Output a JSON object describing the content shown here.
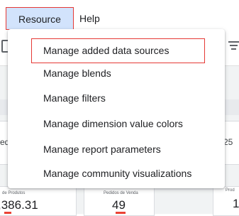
{
  "menubar": {
    "resource_label": "Resource",
    "help_label": "Help"
  },
  "resource_menu": {
    "items": [
      {
        "label": "Manage added data sources",
        "highlighted": true
      },
      {
        "label": "Manage blends"
      },
      {
        "label": "Manage filters"
      },
      {
        "label": "Manage dimension value colors"
      },
      {
        "label": "Manage report parameters"
      },
      {
        "label": "Manage community visualizations"
      }
    ]
  },
  "background": {
    "left_card_text": "ed",
    "right_card_text": "25",
    "kpis": [
      {
        "label": "de Produtos",
        "value": ",386.31"
      },
      {
        "label": "Pedidos de Venda",
        "value": "49"
      },
      {
        "label": "Prod",
        "value": "1"
      }
    ]
  },
  "colors": {
    "highlight_border": "#e53935",
    "active_menu_bg": "#d2e3fc",
    "kpi_delta": "#ea4335"
  }
}
